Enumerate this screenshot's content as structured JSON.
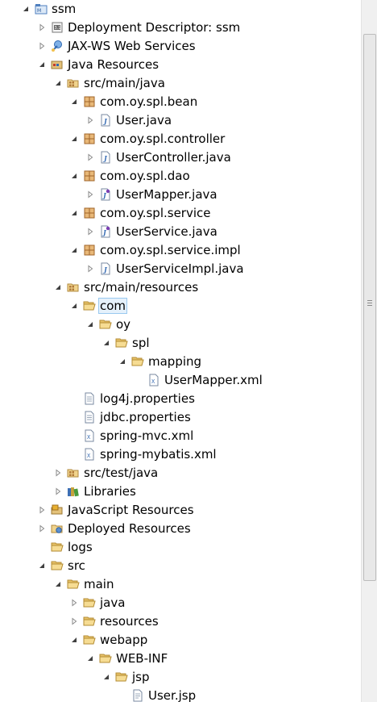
{
  "tree": {
    "nodes": [
      {
        "label": "ssm",
        "level": 0,
        "toggle": "expanded",
        "icon": "project-icon"
      },
      {
        "label": "Deployment Descriptor: ssm",
        "level": 1,
        "toggle": "collapsed",
        "icon": "deployment-descriptor-icon"
      },
      {
        "label": "JAX-WS Web Services",
        "level": 1,
        "toggle": "collapsed",
        "icon": "web-services-icon"
      },
      {
        "label": "Java Resources",
        "level": 1,
        "toggle": "expanded",
        "icon": "java-resources-icon"
      },
      {
        "label": "src/main/java",
        "level": 2,
        "toggle": "expanded",
        "icon": "source-folder-icon"
      },
      {
        "label": "com.oy.spl.bean",
        "level": 3,
        "toggle": "expanded",
        "icon": "package-icon"
      },
      {
        "label": "User.java",
        "level": 4,
        "toggle": "collapsed",
        "icon": "java-file-icon"
      },
      {
        "label": "com.oy.spl.controller",
        "level": 3,
        "toggle": "expanded",
        "icon": "package-icon"
      },
      {
        "label": "UserController.java",
        "level": 4,
        "toggle": "collapsed",
        "icon": "java-file-icon"
      },
      {
        "label": "com.oy.spl.dao",
        "level": 3,
        "toggle": "expanded",
        "icon": "package-icon"
      },
      {
        "label": "UserMapper.java",
        "level": 4,
        "toggle": "collapsed",
        "icon": "java-interface-file-icon"
      },
      {
        "label": "com.oy.spl.service",
        "level": 3,
        "toggle": "expanded",
        "icon": "package-icon"
      },
      {
        "label": "UserService.java",
        "level": 4,
        "toggle": "collapsed",
        "icon": "java-interface-file-icon"
      },
      {
        "label": "com.oy.spl.service.impl",
        "level": 3,
        "toggle": "expanded",
        "icon": "package-icon"
      },
      {
        "label": "UserServiceImpl.java",
        "level": 4,
        "toggle": "collapsed",
        "icon": "java-file-icon"
      },
      {
        "label": "src/main/resources",
        "level": 2,
        "toggle": "expanded",
        "icon": "source-folder-icon"
      },
      {
        "label": "com",
        "level": 3,
        "toggle": "expanded",
        "icon": "folder-open-icon",
        "selected": true
      },
      {
        "label": "oy",
        "level": 4,
        "toggle": "expanded",
        "icon": "folder-open-icon"
      },
      {
        "label": "spl",
        "level": 5,
        "toggle": "expanded",
        "icon": "folder-open-icon"
      },
      {
        "label": "mapping",
        "level": 6,
        "toggle": "expanded",
        "icon": "folder-open-icon"
      },
      {
        "label": "UserMapper.xml",
        "level": 7,
        "toggle": "none",
        "icon": "xml-file-icon"
      },
      {
        "label": "log4j.properties",
        "level": 3,
        "toggle": "none",
        "icon": "properties-file-icon"
      },
      {
        "label": "jdbc.properties",
        "level": 3,
        "toggle": "none",
        "icon": "properties-file-icon"
      },
      {
        "label": "spring-mvc.xml",
        "level": 3,
        "toggle": "none",
        "icon": "xml-file-icon"
      },
      {
        "label": "spring-mybatis.xml",
        "level": 3,
        "toggle": "none",
        "icon": "xml-file-icon"
      },
      {
        "label": "src/test/java",
        "level": 2,
        "toggle": "collapsed",
        "icon": "source-folder-icon"
      },
      {
        "label": "Libraries",
        "level": 2,
        "toggle": "collapsed",
        "icon": "libraries-icon"
      },
      {
        "label": "JavaScript Resources",
        "level": 1,
        "toggle": "collapsed",
        "icon": "javascript-resources-icon"
      },
      {
        "label": "Deployed Resources",
        "level": 1,
        "toggle": "collapsed",
        "icon": "deployed-resources-icon"
      },
      {
        "label": "logs",
        "level": 1,
        "toggle": "none",
        "icon": "folder-open-icon"
      },
      {
        "label": "src",
        "level": 1,
        "toggle": "expanded",
        "icon": "folder-open-icon"
      },
      {
        "label": "main",
        "level": 2,
        "toggle": "expanded",
        "icon": "folder-open-icon"
      },
      {
        "label": "java",
        "level": 3,
        "toggle": "collapsed",
        "icon": "folder-open-icon"
      },
      {
        "label": "resources",
        "level": 3,
        "toggle": "collapsed",
        "icon": "folder-open-icon"
      },
      {
        "label": "webapp",
        "level": 3,
        "toggle": "expanded",
        "icon": "folder-open-icon"
      },
      {
        "label": "WEB-INF",
        "level": 4,
        "toggle": "expanded",
        "icon": "folder-open-icon"
      },
      {
        "label": "jsp",
        "level": 5,
        "toggle": "expanded",
        "icon": "folder-open-icon"
      },
      {
        "label": "User.jsp",
        "level": 6,
        "toggle": "none",
        "icon": "jsp-file-icon"
      }
    ]
  },
  "colors": {
    "selection_bg": "#e5f1fb",
    "selection_border": "#99c9ef",
    "folder": "#e8c36a",
    "package": "#b07a3a",
    "java_blue": "#3b6fb6"
  }
}
